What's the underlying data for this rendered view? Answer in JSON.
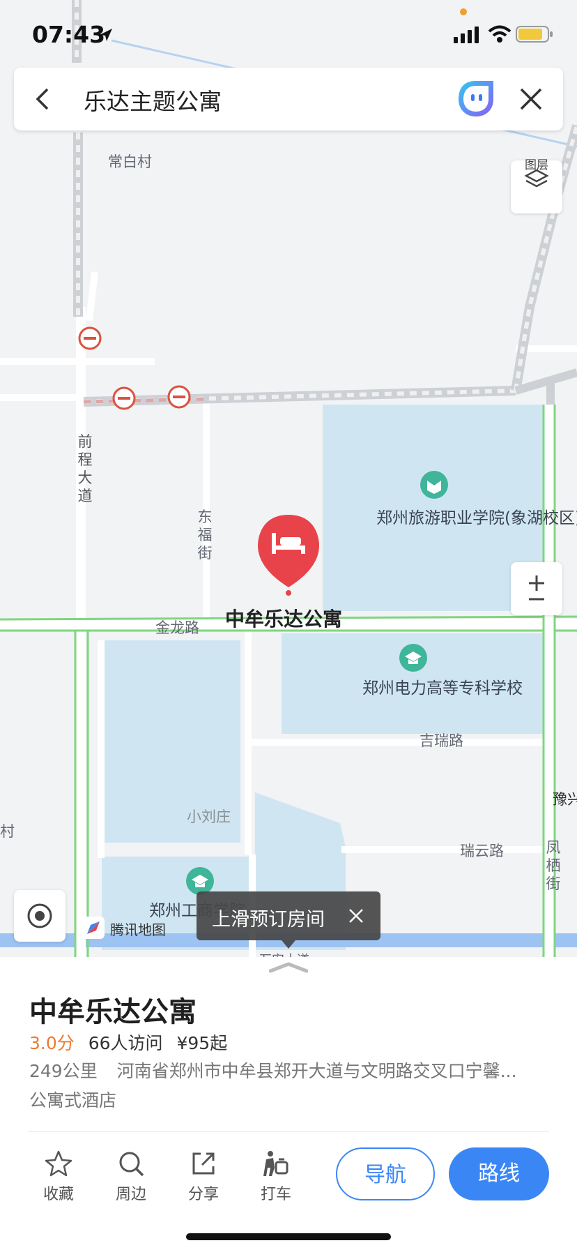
{
  "status_bar": {
    "time": "07:43"
  },
  "search": {
    "query": "乐达主题公寓"
  },
  "map": {
    "layers_label": "图层",
    "zoom_label": "± —",
    "labels": {
      "village_changbai": "常白村",
      "road_qiancheng": "前程大道",
      "road_dongfu": "东福街",
      "road_jinlong": "金龙路",
      "road_jirui": "吉瑞路",
      "road_ruiyun": "瑞云路",
      "road_fengqi": "凤栖街",
      "road_yuxing": "豫兴",
      "village_xiaoliu": "小刘庄",
      "poi_tourism_college": "郑州旅游职业学院(象湖校区)",
      "poi_electric_college": "郑州电力高等专科学校",
      "poi_business_college": "郑州工商学院",
      "road_bottom": "万安大道",
      "selected_place": "中牟乐达公寓",
      "left_edge": "村"
    },
    "brand": "腾讯地图",
    "toast": "上滑预订房间"
  },
  "place": {
    "name": "中牟乐达公寓",
    "rating": "3.0分",
    "visits": "66人访问",
    "price": "¥95起",
    "distance": "249公里",
    "address": "河南省郑州市中牟县郑开大道与文明路交叉口宁馨...",
    "category": "公寓式酒店"
  },
  "actions": {
    "favorite": "收藏",
    "nearby": "周边",
    "share": "分享",
    "taxi": "打车",
    "navigate": "导航",
    "route": "路线"
  },
  "colors": {
    "accent": "#3b86f5",
    "rating": "#ee7a2e",
    "marker": "#e8434a",
    "campus": "#cfe6f2",
    "road_green": "#7fd67f"
  }
}
